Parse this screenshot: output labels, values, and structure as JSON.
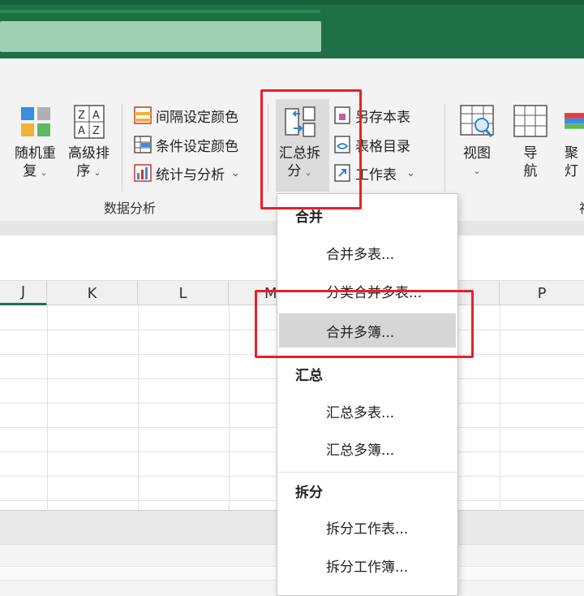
{
  "ribbon": {
    "random_repeat": {
      "line1": "随机重",
      "line2": "复"
    },
    "advanced_sort": {
      "line1": "高级排",
      "line2": "序"
    },
    "interval_color": "间隔设定颜色",
    "condition_color": "条件设定颜色",
    "stats_analysis": "统计与分析",
    "summary_split": {
      "line1": "汇总拆",
      "line2": "分"
    },
    "save_as_table": "另存本表",
    "table_dir": "表格目录",
    "worksheet": "工作表",
    "view": {
      "line1": "视图"
    },
    "nav": {
      "line1": "导",
      "line2": "航"
    },
    "spotlight": {
      "line1": "聚",
      "line2": "灯"
    },
    "group_label": "数据分析",
    "group_label2": "视"
  },
  "columns": [
    "J",
    "K",
    "L",
    "M",
    "P"
  ],
  "dropdown": {
    "section_merge": "合并",
    "merge_sheets": "合并多表...",
    "merge_category": "分类合并多表...",
    "merge_books": "合并多簿...",
    "section_summary": "汇总",
    "summary_sheets": "汇总多表...",
    "summary_books": "汇总多簿...",
    "section_split": "拆分",
    "split_sheet": "拆分工作表...",
    "split_book": "拆分工作簿..."
  },
  "colors": {
    "accent": "#1e7145",
    "highlight_box": "#e8202a"
  }
}
